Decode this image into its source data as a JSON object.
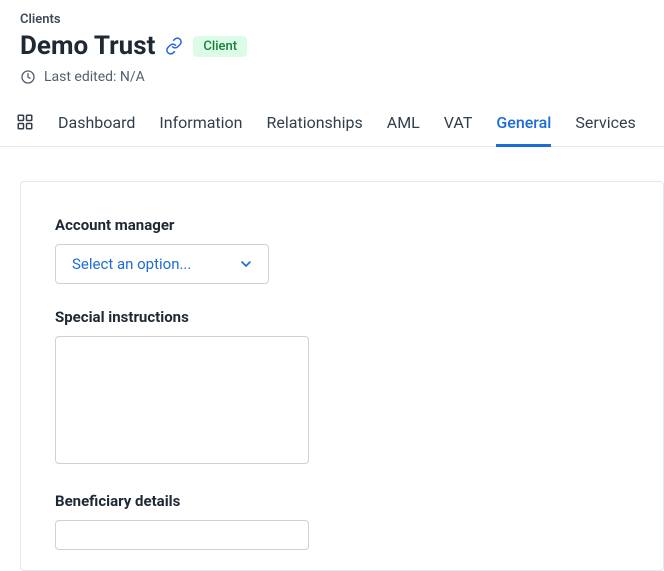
{
  "breadcrumb": "Clients",
  "title": "Demo Trust",
  "badge": "Client",
  "last_edited_label": "Last edited: N/A",
  "tabs": {
    "dashboard": "Dashboard",
    "information": "Information",
    "relationships": "Relationships",
    "aml": "AML",
    "vat": "VAT",
    "general": "General",
    "services": "Services"
  },
  "form": {
    "account_manager": {
      "label": "Account manager",
      "placeholder": "Select an option..."
    },
    "special_instructions": {
      "label": "Special instructions",
      "value": ""
    },
    "beneficiary_details": {
      "label": "Beneficiary details",
      "value": ""
    }
  }
}
